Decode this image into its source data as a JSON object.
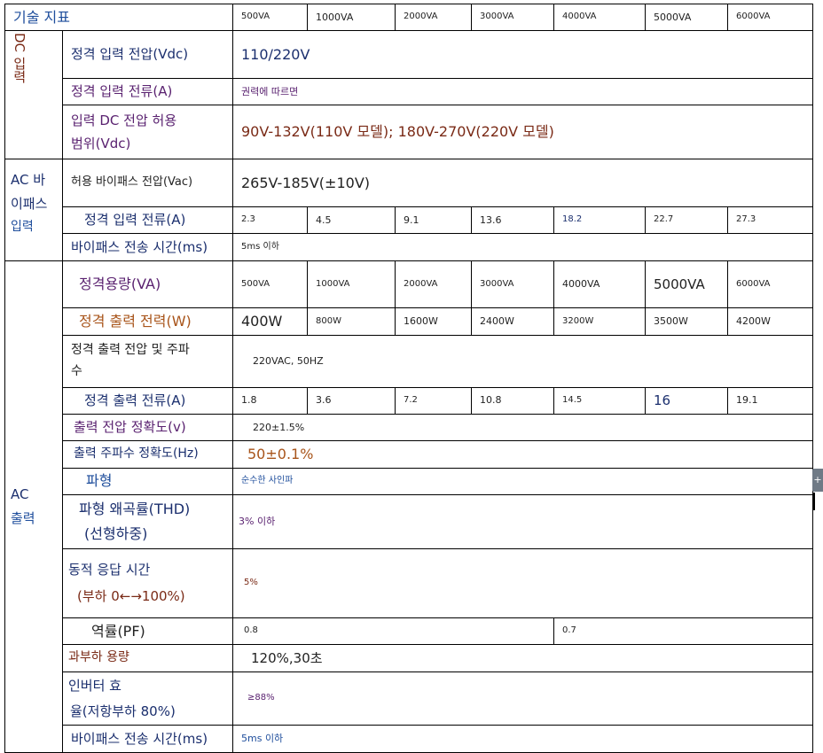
{
  "header": {
    "label": "기술 지표",
    "capacities": [
      "500VA",
      "1000VA",
      "2000VA",
      "3000VA",
      "4000VA",
      "5000VA",
      "6000VA"
    ]
  },
  "dc_input": {
    "category": "DC 입력",
    "rated_voltage": {
      "label": "정격 입력 전압(Vdc)",
      "value": "110/220V"
    },
    "rated_current": {
      "label": "정격 입력 전류(A)",
      "value": "권력에 따르면"
    },
    "voltage_range": {
      "label_1": "입력 DC 전압 허용",
      "label_2": "범위(Vdc)",
      "value": "90V-132V(110V 모델); 180V-270V(220V 모델)"
    }
  },
  "ac_bypass": {
    "category_1": "AC 바",
    "category_2": "이패스",
    "category_3": "입력",
    "voltage": {
      "label": "허용 바이패스 전압(Vac)",
      "value": "265V-185V(±10V)"
    },
    "current": {
      "label": "정격 입력 전류(A)",
      "values": [
        "2.3",
        "4.5",
        "9.1",
        "13.6",
        "18.2",
        "22.7",
        "27.3"
      ]
    },
    "transfer_time": {
      "label": "바이패스 전송 시간(ms)",
      "value": "5ms 이하"
    }
  },
  "ac_output": {
    "category_1": "AC",
    "category_2": "출력",
    "capacity": {
      "label": "정격용량(VA)",
      "values": [
        "500VA",
        "1000VA",
        "2000VA",
        "3000VA",
        "4000VA",
        "5000VA",
        "6000VA"
      ]
    },
    "power": {
      "label": "정격 출력 전력(W)",
      "values": [
        "400W",
        "800W",
        "1600W",
        "2400W",
        "3200W",
        "3500W",
        "4200W"
      ]
    },
    "voltage_freq": {
      "label_1": "정격 출력 전압 및 주파",
      "label_2": "수",
      "value": "220VAC, 50HZ"
    },
    "current": {
      "label": "정격 출력 전류(A)",
      "values": [
        "1.8",
        "3.6",
        "7.2",
        "10.8",
        "14.5",
        "16",
        "19.1"
      ]
    },
    "voltage_accuracy": {
      "label": "출력 전압 정확도(v)",
      "value": "220±1.5%"
    },
    "freq_accuracy": {
      "label": "출력 주파수 정확도(Hz)",
      "value": "50±0.1%"
    },
    "waveform": {
      "label": "파형",
      "value": "순수한 사인파"
    },
    "thd": {
      "label_1": "파형 왜곡률(THD)",
      "label_2": "(선형하중)",
      "value": "3% 이하"
    },
    "dynamic": {
      "label_1": "동적 응답 시간",
      "label_2": "(부하 0←→100%)",
      "value": "5%"
    },
    "power_factor": {
      "label": "역률(PF)",
      "value_1": "0.8",
      "value_2": "0.7"
    },
    "overload": {
      "label": "과부하 용량",
      "value": "120%,30초"
    },
    "efficiency": {
      "label_1": "인버터 효",
      "label_2": "율(저항부하 80%)",
      "value": "≥88%"
    },
    "transfer_time": {
      "label": "바이패스 전송 시간(ms)",
      "value": "5ms 이하"
    }
  }
}
